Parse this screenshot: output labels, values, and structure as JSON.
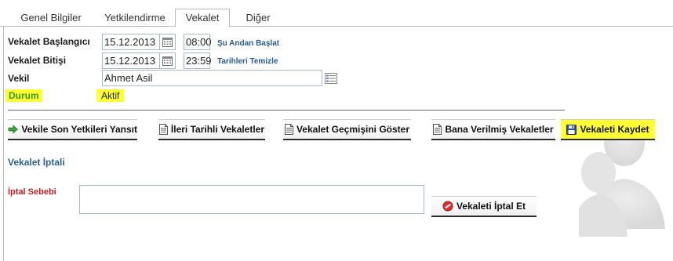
{
  "tabs": [
    {
      "label": "Genel Bilgiler"
    },
    {
      "label": "Yetkilendirme"
    },
    {
      "label": "Vekalet"
    },
    {
      "label": "Diğer"
    }
  ],
  "form": {
    "start_label": "Vekalet Başlangıcı",
    "start_date": "15.12.2013",
    "start_time": "08:00",
    "start_link": "Şu Andan Başlat",
    "end_label": "Vekalet Bitişi",
    "end_date": "15.12.2013",
    "end_time": "23:59",
    "end_link": "Tarihleri Temizle",
    "proxy_label": "Vekil",
    "proxy_value": "Ahmet Asil",
    "status_label": "Durum",
    "status_value": "Aktif"
  },
  "actions": {
    "apply_label": "Vekile Son Yetkileri Yansıt",
    "future_label": "İleri Tarihli Vekaletler",
    "history_label": "Vekalet Geçmişini Göster",
    "given_label": "Bana Verilmiş Vekaletler",
    "save_label": "Vekaleti Kaydet"
  },
  "cancel": {
    "section_title": "Vekalet İptali",
    "reason_label": "İptal Sebebi",
    "reason_value": "",
    "cancel_button_label": "Vekaleti İptal Et"
  },
  "colors": {
    "highlight": "#ffff33",
    "link": "#2a5a96",
    "status_label": "#3a9a1a",
    "cancel_label": "#c0202a",
    "section_title": "#2f5f8f"
  }
}
